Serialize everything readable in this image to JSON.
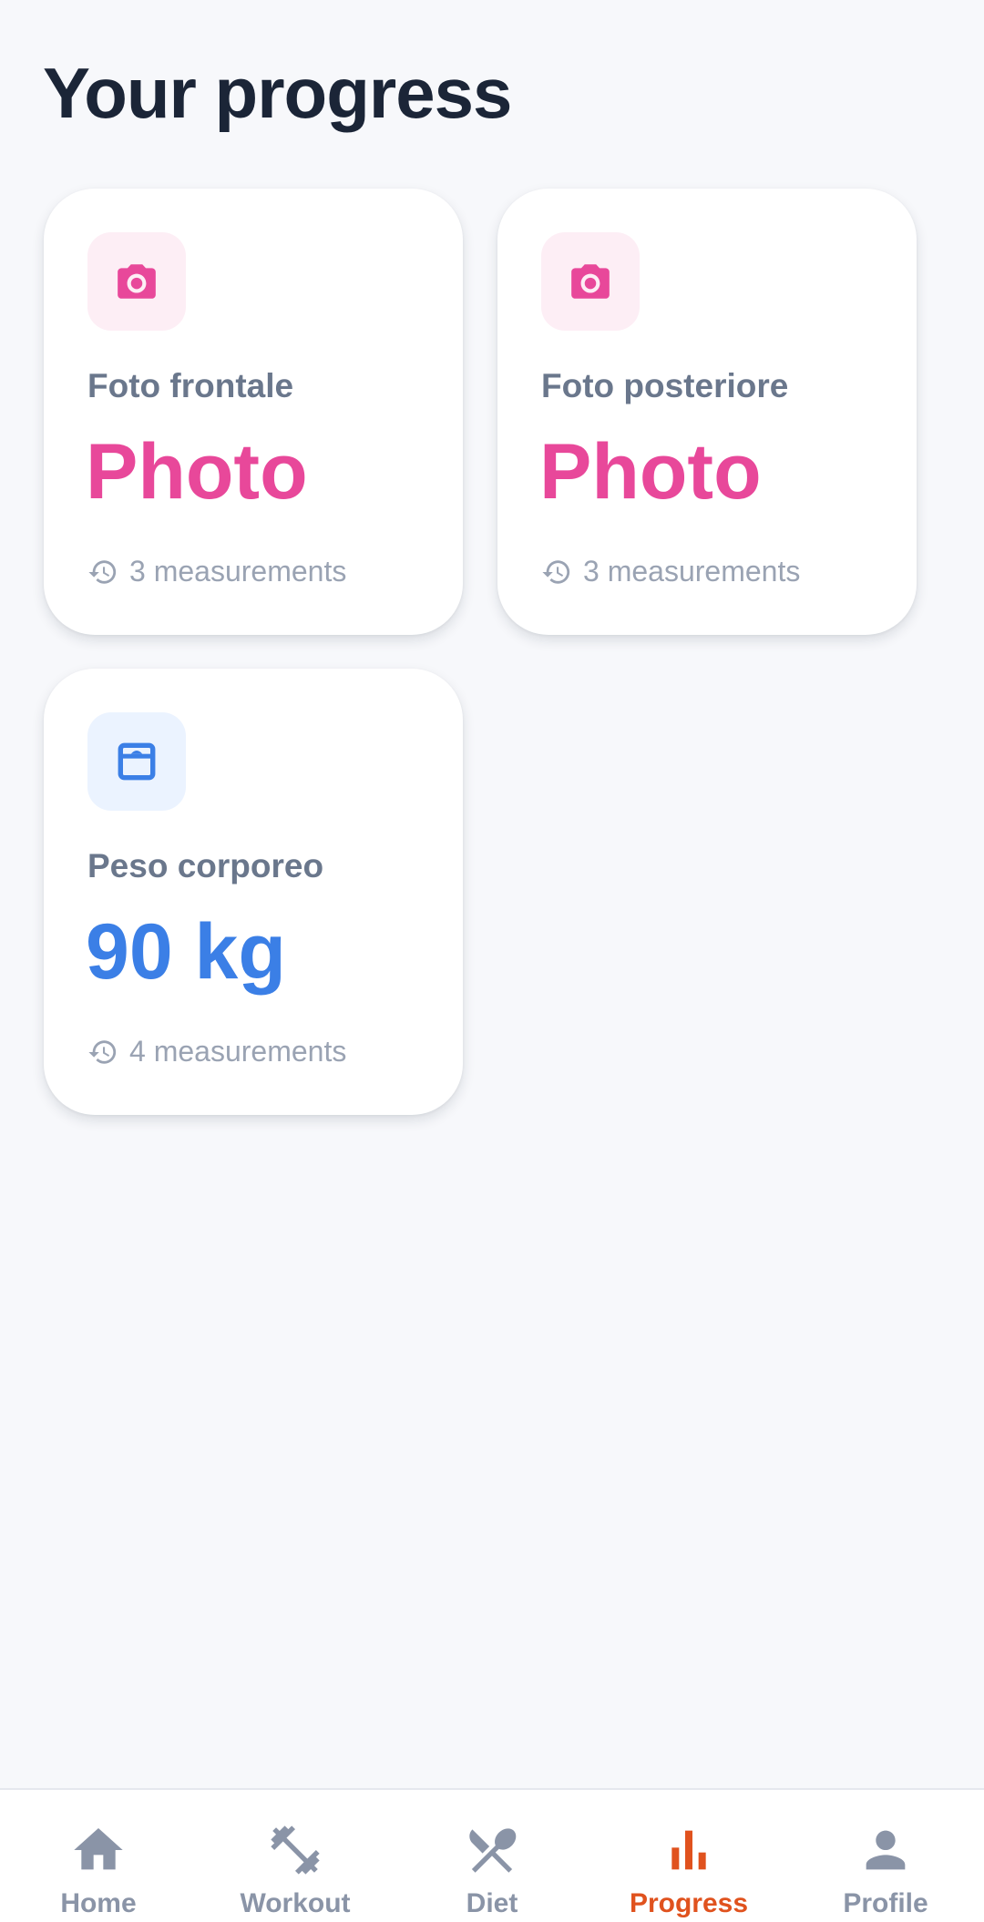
{
  "header": {
    "title": "Your progress"
  },
  "cards": [
    {
      "icon": "camera-icon",
      "label": "Foto frontale",
      "value": "Photo",
      "measurements": "3 measurements",
      "accent": "#e8489a",
      "icon_bg": "#fdeef5"
    },
    {
      "icon": "camera-icon",
      "label": "Foto posteriore",
      "value": "Photo",
      "measurements": "3 measurements",
      "accent": "#e8489a",
      "icon_bg": "#fdeef5"
    },
    {
      "icon": "scale-icon",
      "label": "Peso corporeo",
      "value": "90 kg",
      "measurements": "4 measurements",
      "accent": "#3b7fe6",
      "icon_bg": "#ebf3ff"
    }
  ],
  "nav": {
    "items": [
      {
        "label": "Home",
        "icon": "home-icon",
        "active": false
      },
      {
        "label": "Workout",
        "icon": "dumbbell-icon",
        "active": false
      },
      {
        "label": "Diet",
        "icon": "utensils-icon",
        "active": false
      },
      {
        "label": "Progress",
        "icon": "bar-chart-icon",
        "active": true
      },
      {
        "label": "Profile",
        "icon": "person-icon",
        "active": false
      }
    ],
    "active_color": "#e0521e",
    "inactive_color": "#8a94a7"
  }
}
